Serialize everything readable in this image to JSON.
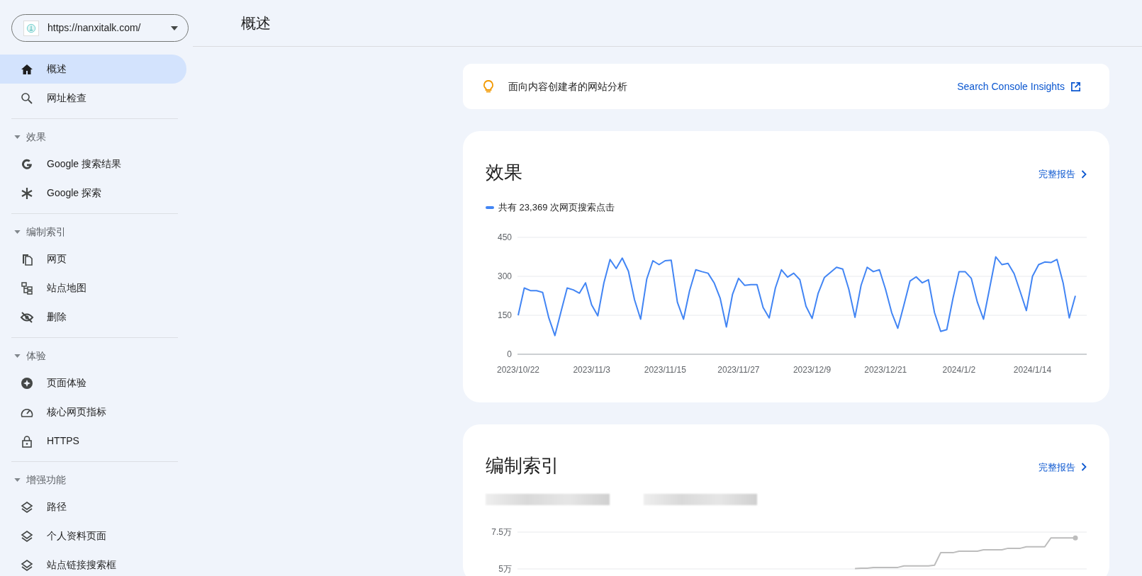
{
  "property": {
    "url": "https://nanxitalk.com/"
  },
  "sidebar": {
    "sections": [
      {
        "items": [
          {
            "label": "概述",
            "selected": true
          },
          {
            "label": "网址检查",
            "selected": false
          }
        ]
      },
      {
        "heading": "效果",
        "expanded": true,
        "items": [
          {
            "label": "Google 搜索结果",
            "selected": false
          },
          {
            "label": "Google 探索",
            "selected": false
          }
        ]
      },
      {
        "heading": "编制索引",
        "expanded": true,
        "items": [
          {
            "label": "网页",
            "selected": false
          },
          {
            "label": "站点地图",
            "selected": false
          },
          {
            "label": "删除",
            "selected": false
          }
        ]
      },
      {
        "heading": "体验",
        "expanded": true,
        "items": [
          {
            "label": "页面体验",
            "selected": false
          },
          {
            "label": "核心网页指标",
            "selected": false
          },
          {
            "label": "HTTPS",
            "selected": false
          }
        ]
      },
      {
        "heading": "增强功能",
        "expanded": true,
        "items": [
          {
            "label": "路径",
            "selected": false
          },
          {
            "label": "个人资料页面",
            "selected": false
          },
          {
            "label": "站点链接搜索框",
            "selected": false
          }
        ]
      }
    ]
  },
  "page_title": "概述",
  "banner": {
    "text": "面向内容创建者的网站分析",
    "link": "Search Console Insights"
  },
  "performance": {
    "title": "效果",
    "link": "完整报告",
    "legend": "共有 23,369 次网页搜索点击",
    "chart_data": {
      "type": "line",
      "ylim": [
        0,
        450
      ],
      "yticks": [
        0,
        150,
        300,
        450
      ],
      "categories": [
        "2023/10/22",
        null,
        null,
        null,
        null,
        null,
        null,
        null,
        null,
        null,
        null,
        null,
        "2023/11/3",
        null,
        null,
        null,
        null,
        null,
        null,
        null,
        null,
        null,
        null,
        null,
        "2023/11/15",
        null,
        null,
        null,
        null,
        null,
        null,
        null,
        null,
        null,
        null,
        null,
        "2023/11/27",
        null,
        null,
        null,
        null,
        null,
        null,
        null,
        null,
        null,
        null,
        null,
        "2023/12/9",
        null,
        null,
        null,
        null,
        null,
        null,
        null,
        null,
        null,
        null,
        null,
        "2023/12/21",
        null,
        null,
        null,
        null,
        null,
        null,
        null,
        null,
        null,
        null,
        null,
        "2024/1/2",
        null,
        null,
        null,
        null,
        null,
        null,
        null,
        null,
        null,
        null,
        null,
        "2024/1/14",
        null,
        null,
        null,
        null,
        null,
        null,
        null
      ],
      "series": [
        {
          "color": "#4285f4",
          "values": [
            150,
            255,
            245,
            245,
            238,
            140,
            72,
            165,
            255,
            248,
            235,
            275,
            190,
            148,
            275,
            365,
            330,
            370,
            320,
            210,
            135,
            290,
            360,
            345,
            360,
            362,
            200,
            135,
            245,
            325,
            318,
            312,
            275,
            215,
            105,
            230,
            292,
            265,
            268,
            268,
            180,
            140,
            255,
            325,
            297,
            312,
            287,
            185,
            138,
            235,
            295,
            315,
            335,
            328,
            250,
            142,
            265,
            335,
            318,
            325,
            250,
            160,
            100,
            190,
            282,
            298,
            275,
            287,
            160,
            88,
            95,
            215,
            318,
            318,
            292,
            200,
            135,
            255,
            375,
            345,
            350,
            310,
            240,
            168,
            300,
            345,
            355,
            353,
            365,
            275,
            140,
            225
          ]
        }
      ]
    }
  },
  "indexing": {
    "title": "编制索引",
    "link": "完整报告",
    "chart_data": {
      "type": "line",
      "ylim": [
        5,
        7.5
      ],
      "yticks": [
        {
          "value": 5,
          "label": "5万"
        },
        {
          "value": 7.5,
          "label": "7.5万"
        }
      ],
      "series": [
        {
          "color": "#bdbdbd",
          "values": [
            null,
            null,
            null,
            null,
            null,
            null,
            null,
            null,
            null,
            null,
            null,
            null,
            null,
            null,
            null,
            null,
            null,
            null,
            null,
            null,
            null,
            null,
            null,
            null,
            null,
            null,
            null,
            null,
            null,
            null,
            null,
            null,
            null,
            null,
            null,
            null,
            null,
            null,
            null,
            null,
            null,
            null,
            null,
            null,
            null,
            null,
            null,
            null,
            null,
            null,
            null,
            null,
            null,
            null,
            null,
            5.03,
            5.05,
            5.05,
            5.1,
            5.1,
            5.1,
            5.1,
            5.1,
            5.2,
            5.2,
            5.2,
            5.2,
            5.2,
            5.25,
            6.1,
            6.1,
            6.1,
            6.2,
            6.2,
            6.2,
            6.2,
            6.3,
            6.3,
            6.3,
            6.3,
            6.4,
            6.4,
            6.4,
            6.5,
            6.5,
            6.5,
            6.5,
            7.1,
            7.1,
            7.1,
            7.1,
            7.1
          ]
        }
      ]
    }
  }
}
